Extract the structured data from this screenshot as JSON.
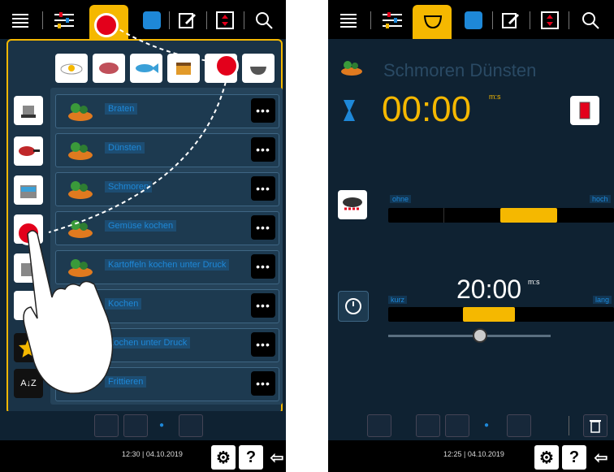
{
  "left": {
    "rows": [
      {
        "label": "Braten"
      },
      {
        "label": "Dünsten"
      },
      {
        "label": "Schmoren"
      },
      {
        "label": "Gemüse kochen"
      },
      {
        "label": "Kartoffeln kochen unter Druck"
      },
      {
        "label": "Kochen"
      },
      {
        "label": "Kochen unter Druck"
      },
      {
        "label": "Frittieren"
      }
    ],
    "more_label": "•••",
    "datetime": "12:30  |  04.10.2019"
  },
  "right": {
    "program_title": "Schmoren  Dünsten",
    "cook_time": "00:00",
    "cook_time_unit": "m:s",
    "heat_low_label": "ohne",
    "heat_high_label": "hoch",
    "timer_time": "20:00",
    "timer_unit": "m:s",
    "timer_low_label": "kurz",
    "timer_high_label": "lang",
    "datetime": "12:25  |  04.10.2019"
  },
  "icons": {
    "help": "?",
    "back": "↩",
    "settings": "⚙",
    "trash": "🗑",
    "pot": "🍲"
  },
  "colors": {
    "accent": "#f5b800",
    "blue": "#1e88d8",
    "red": "#e3001b",
    "bg": "#0f2232"
  }
}
